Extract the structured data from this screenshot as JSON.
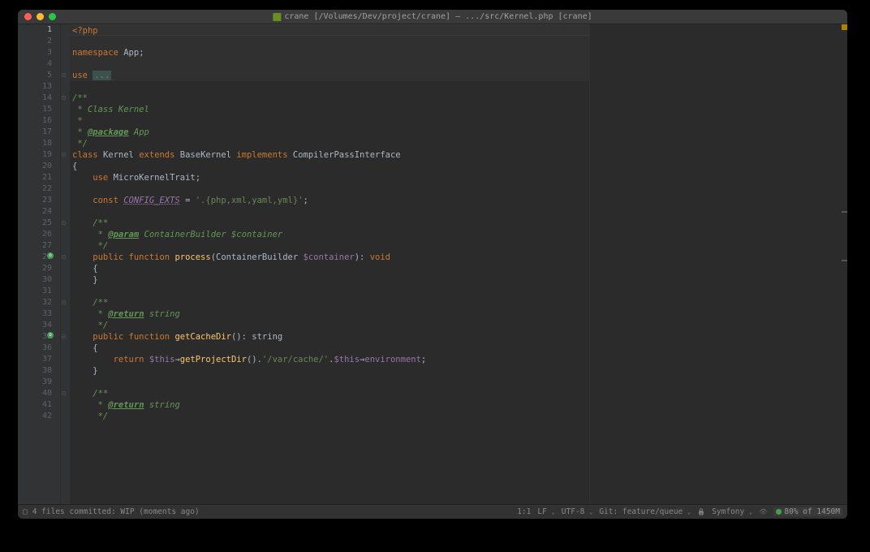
{
  "title": "crane [/Volumes/Dev/project/crane] – .../src/Kernel.php [crane]",
  "lines": [
    {
      "n": "1",
      "c": "current"
    },
    {
      "n": "2"
    },
    {
      "n": "3"
    },
    {
      "n": "4"
    },
    {
      "n": "5"
    },
    {
      "n": "13"
    },
    {
      "n": "14"
    },
    {
      "n": "15"
    },
    {
      "n": "16"
    },
    {
      "n": "17"
    },
    {
      "n": "18"
    },
    {
      "n": "19"
    },
    {
      "n": "20"
    },
    {
      "n": "21"
    },
    {
      "n": "22"
    },
    {
      "n": "23"
    },
    {
      "n": "24"
    },
    {
      "n": "25"
    },
    {
      "n": "26"
    },
    {
      "n": "27"
    },
    {
      "n": "28",
      "m": true
    },
    {
      "n": "29"
    },
    {
      "n": "30"
    },
    {
      "n": "31"
    },
    {
      "n": "32"
    },
    {
      "n": "33"
    },
    {
      "n": "34"
    },
    {
      "n": "35",
      "m": true
    },
    {
      "n": "36"
    },
    {
      "n": "37"
    },
    {
      "n": "38"
    },
    {
      "n": "39"
    },
    {
      "n": "40"
    },
    {
      "n": "41"
    },
    {
      "n": "42"
    }
  ],
  "code": {
    "l1": "<?php",
    "l3_ns": "namespace ",
    "l3_app": "App",
    "l3_sc": ";",
    "l5_use": "use ",
    "l5_fold": "...",
    "l14": "/**",
    "l15": " * Class Kernel",
    "l16": " *",
    "l17a": " * ",
    "l17b": "@package",
    "l17c": " App",
    "l18": " */",
    "l19_class": "class ",
    "l19_I": "Kernel ",
    "l19_ext": "extends ",
    "l19_bk": "BaseKernel ",
    "l19_imp": "implements ",
    "l19_ci": "CompilerPassInterface",
    "l20": "{",
    "l21_use": "    use ",
    "l21_t": "MicroKernelTrait",
    "l21_s": ";",
    "l23_const": "    const ",
    "l23_name": "CONFIG_EXTS",
    "l23_eq": " = ",
    "l23_str": "'.{php,xml,yaml,yml}'",
    "l23_s": ";",
    "l25": "    /**",
    "l26a": "     * ",
    "l26b": "@param",
    "l26c": " ContainerBuilder $container",
    "l27": "     */",
    "l28_pub": "    public function ",
    "l28_fn": "process",
    "l28_p": "(ContainerBuilder ",
    "l28_v": "$container",
    "l28_r": "): ",
    "l28_void": "void",
    "l29": "    {",
    "l30": "    }",
    "l32": "    /**",
    "l33a": "     * ",
    "l33b": "@return",
    "l33c": " string",
    "l34": "     */",
    "l35_pub": "    public function ",
    "l35_fn": "getCacheDir",
    "l35_r": "(): ",
    "l35_str": "string",
    "l36": "    {",
    "l37_ret": "        return ",
    "l37_this": "$this",
    "l37_arr": "→",
    "l37_gpd": "getProjectDir",
    "l37_p": "().",
    "l37_str": "'/var/cache/'",
    "l37_dot": ".",
    "l37_this2": "$this",
    "l37_arr2": "→",
    "l37_env": "environment",
    "l37_s": ";",
    "l38": "    }",
    "l40": "    /**",
    "l41a": "     * ",
    "l41b": "@return",
    "l41c": " string",
    "l42": "     */"
  },
  "status": {
    "vcs": "4 files committed: WIP (moments ago)",
    "pos": "1:1",
    "lf": "LF",
    "enc": "UTF-8",
    "git": "Git: feature/queue",
    "fw": "Symfony",
    "mem": "80% of 1450M"
  }
}
